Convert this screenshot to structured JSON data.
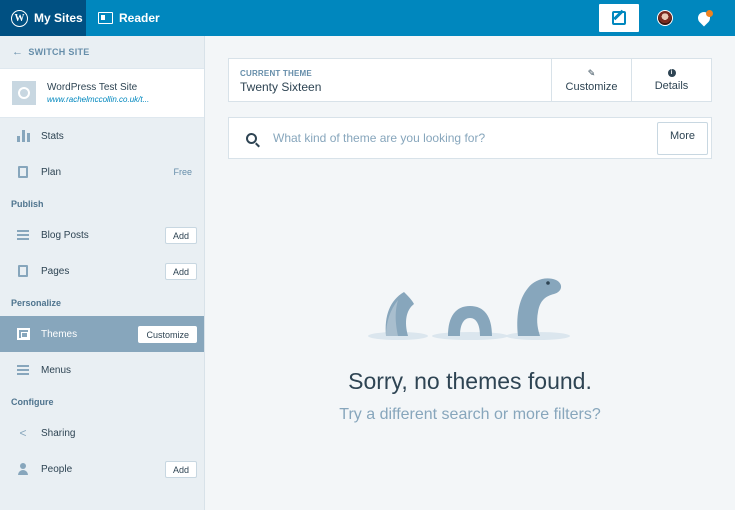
{
  "masterbar": {
    "my_sites_label": "My Sites",
    "reader_label": "Reader",
    "icons": [
      "wordpress-logo-icon",
      "reader-icon",
      "write-post-icon",
      "avatar",
      "notifications-icon"
    ]
  },
  "sidebar": {
    "switch_site": "SWITCH SITE",
    "site": {
      "name": "WordPress Test Site",
      "url": "www.rachelmccollin.co.uk/t..."
    },
    "items": {
      "stats": {
        "label": "Stats"
      },
      "plan": {
        "label": "Plan",
        "badge": "Free"
      },
      "blog_posts": {
        "label": "Blog Posts",
        "action": "Add"
      },
      "pages": {
        "label": "Pages",
        "action": "Add"
      },
      "themes": {
        "label": "Themes",
        "action": "Customize"
      },
      "menus": {
        "label": "Menus"
      },
      "sharing": {
        "label": "Sharing"
      },
      "people": {
        "label": "People",
        "action": "Add"
      }
    },
    "sections": {
      "publish": "Publish",
      "personalize": "Personalize",
      "configure": "Configure"
    }
  },
  "main": {
    "current_theme": {
      "label": "CURRENT THEME",
      "name": "Twenty Sixteen",
      "customize_label": "Customize",
      "details_label": "Details"
    },
    "search": {
      "placeholder": "What kind of theme are you looking for?",
      "more_label": "More"
    },
    "empty": {
      "title": "Sorry, no themes found.",
      "subtitle": "Try a different search or more filters?"
    }
  },
  "colors": {
    "masterbar": "#0087be",
    "masterbar_active": "#005082",
    "sidebar_active": "#87a6bc",
    "text": "#2e4453",
    "muted": "#87a6bc"
  }
}
